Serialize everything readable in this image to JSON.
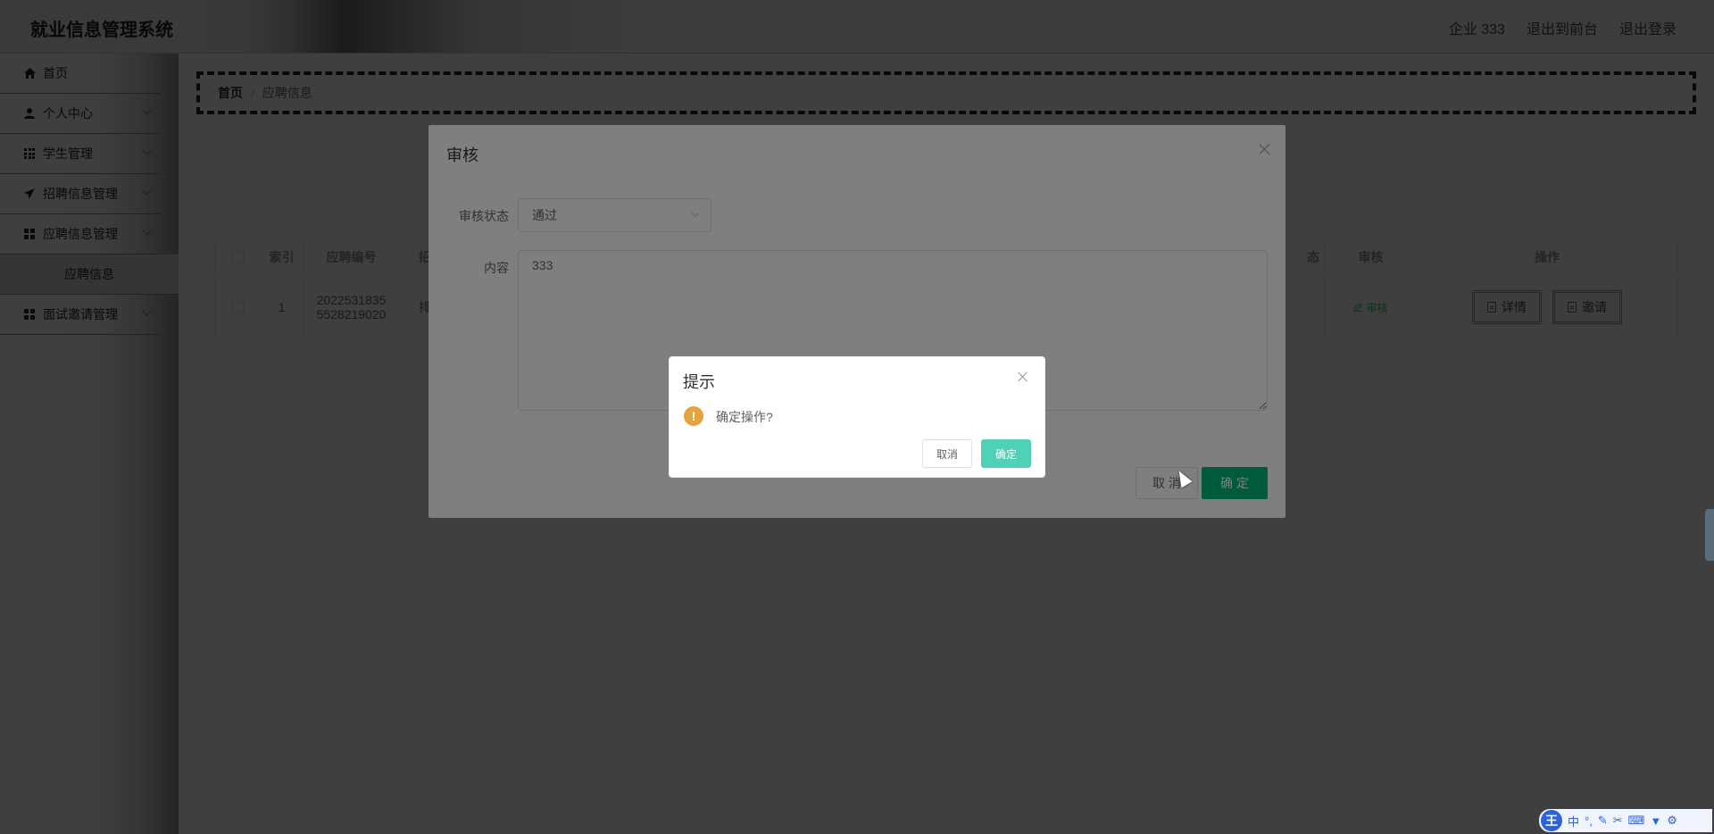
{
  "header": {
    "title": "就业信息管理系统",
    "user": "企业 333",
    "to_front": "退出到前台",
    "logout": "退出登录"
  },
  "sidebar": {
    "items": [
      {
        "label": "首页",
        "icon": "home-icon"
      },
      {
        "label": "个人中心",
        "icon": "user-icon"
      },
      {
        "label": "学生管理",
        "icon": "grid-icon"
      },
      {
        "label": "招聘信息管理",
        "icon": "send-icon"
      },
      {
        "label": "应聘信息管理",
        "icon": "apps-icon"
      },
      {
        "label": "面试邀请管理",
        "icon": "apps-icon"
      }
    ],
    "sub_item": "应聘信息"
  },
  "breadcrumb": {
    "home": "首页",
    "separator": "/",
    "current": "应聘信息"
  },
  "table": {
    "headers": [
      "索引",
      "应聘编号",
      "招",
      "态",
      "审核",
      "操作"
    ],
    "row": {
      "index": "1",
      "number_line1": "2022531835",
      "number_line2": "5528219020",
      "partial_cell": "排",
      "status_partial": "",
      "audit": "审核",
      "detail": "详情",
      "invite": "邀请"
    }
  },
  "audit_dialog": {
    "title": "审核",
    "status_label": "审核状态",
    "status_value": "通过",
    "content_label": "内容",
    "content_value": "333",
    "cancel": "取 消",
    "ok": "确 定"
  },
  "confirm_box": {
    "title": "提示",
    "message": "确定操作?",
    "cancel": "取消",
    "ok": "确定"
  },
  "ime": {
    "logo": "王",
    "mode": "中",
    "punct": "°,"
  },
  "colors": {
    "primary_green": "#00b57a",
    "confirm_green": "#4fd1b6",
    "warning": "#e6a23c",
    "audit_link": "#2ecc71"
  }
}
